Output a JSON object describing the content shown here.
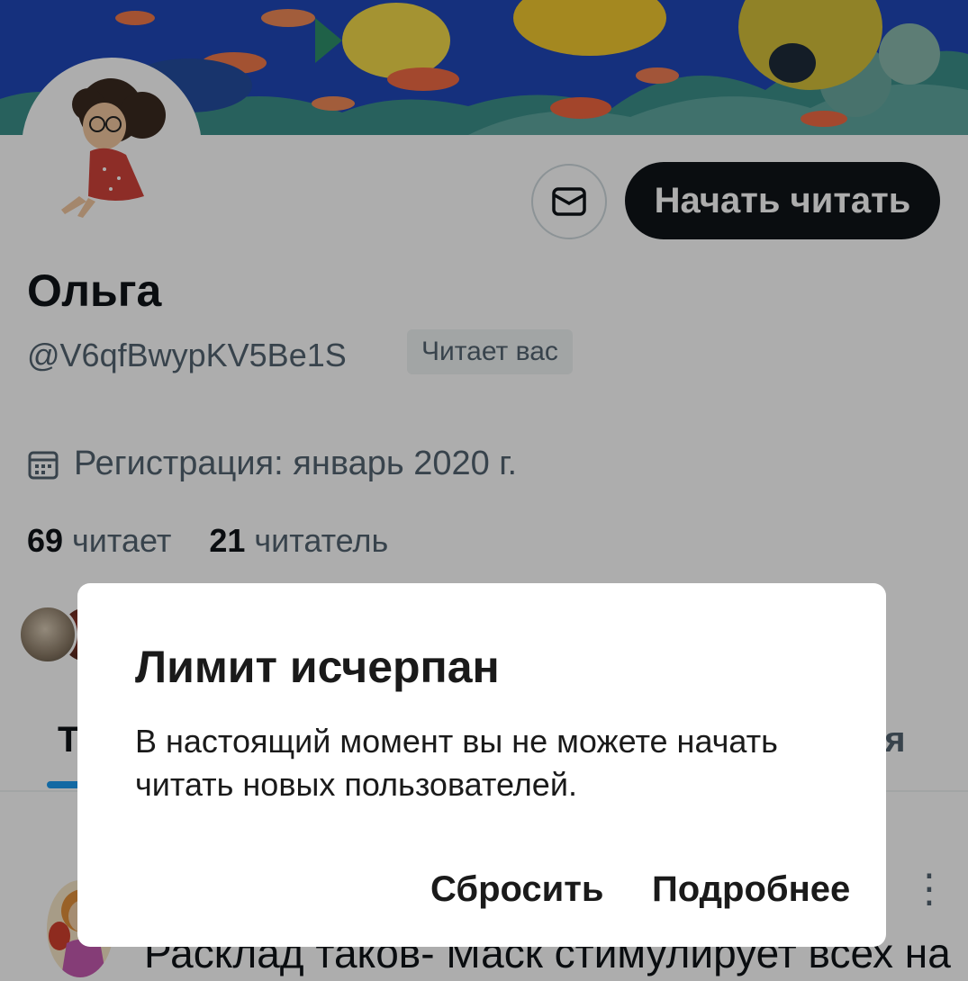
{
  "profile": {
    "name": "Ольга",
    "handle": "@V6qfBwypKV5Be1S",
    "follows_you": "Читает вас",
    "joined": "Регистрация: январь 2020 г.",
    "following_count": "69",
    "following_label": "читает",
    "followers_count": "21",
    "followers_label": "читатель"
  },
  "actions": {
    "follow_label": "Начать читать",
    "message_icon": "mail-icon"
  },
  "tabs": {
    "left_partial": "Т",
    "right_partial": "ся"
  },
  "tweet": {
    "text_partial": "Расклад таков- Маск стимулирует всех на"
  },
  "dialog": {
    "title": "Лимит исчерпан",
    "body": "В настоящий момент вы не можете начать читать новых пользователей.",
    "reset_label": "Сбросить",
    "more_label": "Подробнее"
  },
  "colors": {
    "primary_text": "#0f1419",
    "secondary_text": "#536471",
    "accent": "#1d9bf0",
    "follow_button": "#0f1419",
    "scrim": "rgba(0,0,0,0.32)"
  }
}
